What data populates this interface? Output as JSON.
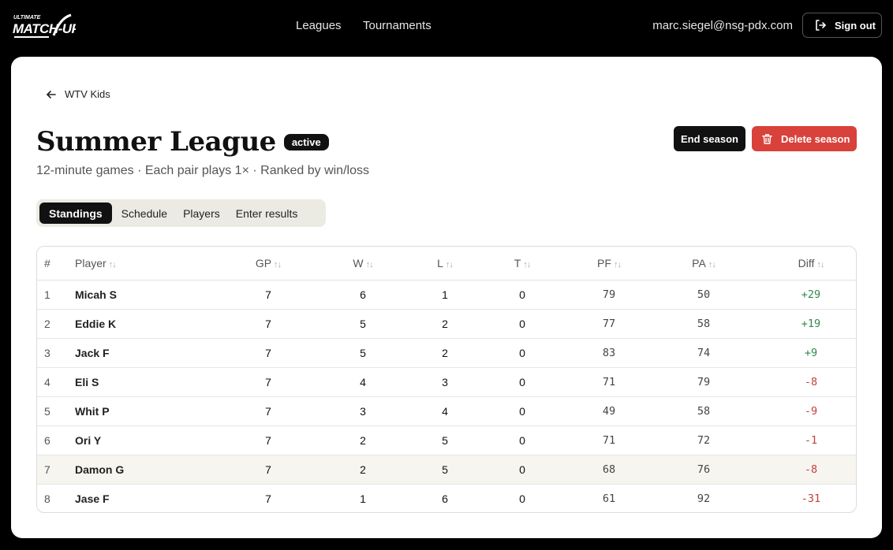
{
  "header": {
    "logo_top": "ULTIMATE",
    "logo_main": "MATCH-UP",
    "nav": [
      {
        "label": "Leagues"
      },
      {
        "label": "Tournaments"
      }
    ],
    "user_email": "marc.siegel@nsg-pdx.com",
    "signout_label": "Sign out"
  },
  "page": {
    "back_label": "WTV Kids",
    "title": "Summer League",
    "status": "active",
    "subtitle": "12-minute games · Each pair plays 1× · Ranked by win/loss",
    "end_label": "End season",
    "delete_label": "Delete season",
    "colors": {
      "danger": "#d9413b",
      "positive": "#2f8a4e",
      "negative": "#c0413b"
    }
  },
  "tabs": [
    {
      "label": "Standings",
      "active": true
    },
    {
      "label": "Schedule"
    },
    {
      "label": "Players"
    },
    {
      "label": "Enter results"
    }
  ],
  "table": {
    "headers": {
      "rank": "#",
      "player": "Player",
      "gp": "GP",
      "w": "W",
      "l": "L",
      "t": "T",
      "pf": "PF",
      "pa": "PA",
      "diff": "Diff"
    },
    "rows": [
      {
        "rank": "1",
        "player": "Micah S",
        "gp": "7",
        "w": "6",
        "l": "1",
        "t": "0",
        "pf": "79",
        "pa": "50",
        "diff": "+29"
      },
      {
        "rank": "2",
        "player": "Eddie K",
        "gp": "7",
        "w": "5",
        "l": "2",
        "t": "0",
        "pf": "77",
        "pa": "58",
        "diff": "+19"
      },
      {
        "rank": "3",
        "player": "Jack F",
        "gp": "7",
        "w": "5",
        "l": "2",
        "t": "0",
        "pf": "83",
        "pa": "74",
        "diff": "+9"
      },
      {
        "rank": "4",
        "player": "Eli S",
        "gp": "7",
        "w": "4",
        "l": "3",
        "t": "0",
        "pf": "71",
        "pa": "79",
        "diff": "-8"
      },
      {
        "rank": "5",
        "player": "Whit P",
        "gp": "7",
        "w": "3",
        "l": "4",
        "t": "0",
        "pf": "49",
        "pa": "58",
        "diff": "-9"
      },
      {
        "rank": "6",
        "player": "Ori Y",
        "gp": "7",
        "w": "2",
        "l": "5",
        "t": "0",
        "pf": "71",
        "pa": "72",
        "diff": "-1"
      },
      {
        "rank": "7",
        "player": "Damon G",
        "gp": "7",
        "w": "2",
        "l": "5",
        "t": "0",
        "pf": "68",
        "pa": "76",
        "diff": "-8"
      },
      {
        "rank": "8",
        "player": "Jase F",
        "gp": "7",
        "w": "1",
        "l": "6",
        "t": "0",
        "pf": "61",
        "pa": "92",
        "diff": "-31"
      }
    ]
  }
}
